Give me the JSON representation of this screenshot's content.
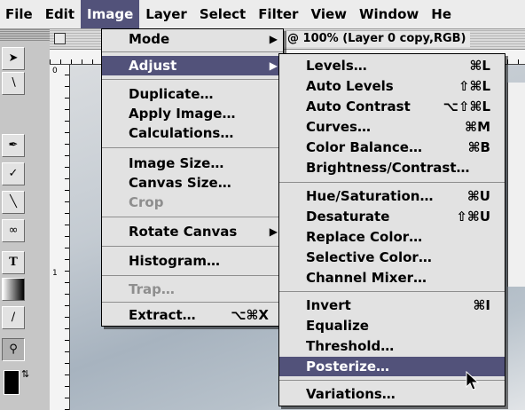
{
  "menubar": [
    "File",
    "Edit",
    "Image",
    "Layer",
    "Select",
    "Filter",
    "View",
    "Window",
    "He"
  ],
  "document": {
    "title": "@ 100% (Layer 0 copy,RGB)",
    "ruler_marks": [
      "0",
      "1"
    ]
  },
  "image_menu": {
    "items": [
      {
        "label": "Mode",
        "submenu": true,
        "shortcut": "",
        "enabled": true
      },
      {
        "label": "Adjust",
        "submenu": true,
        "shortcut": "",
        "enabled": true,
        "highlighted": true
      },
      {
        "label": "Duplicate…",
        "submenu": false,
        "shortcut": "",
        "enabled": true
      },
      {
        "label": "Apply Image…",
        "submenu": false,
        "shortcut": "",
        "enabled": true
      },
      {
        "label": "Calculations…",
        "submenu": false,
        "shortcut": "",
        "enabled": true
      },
      {
        "label": "Image Size…",
        "submenu": false,
        "shortcut": "",
        "enabled": true
      },
      {
        "label": "Canvas Size…",
        "submenu": false,
        "shortcut": "",
        "enabled": true
      },
      {
        "label": "Crop",
        "submenu": false,
        "shortcut": "",
        "enabled": false
      },
      {
        "label": "Rotate Canvas",
        "submenu": true,
        "shortcut": "",
        "enabled": true
      },
      {
        "label": "Histogram…",
        "submenu": false,
        "shortcut": "",
        "enabled": true
      },
      {
        "label": "Trap…",
        "submenu": false,
        "shortcut": "",
        "enabled": false
      },
      {
        "label": "Extract…",
        "submenu": false,
        "shortcut": "⌥⌘X",
        "enabled": true
      }
    ]
  },
  "adjust_menu": {
    "items": [
      {
        "label": "Levels…",
        "shortcut": "⌘L"
      },
      {
        "label": "Auto Levels",
        "shortcut": "⇧⌘L"
      },
      {
        "label": "Auto Contrast",
        "shortcut": "⌥⇧⌘L"
      },
      {
        "label": "Curves…",
        "shortcut": "⌘M"
      },
      {
        "label": "Color Balance…",
        "shortcut": "⌘B"
      },
      {
        "label": "Brightness/Contrast…",
        "shortcut": ""
      },
      {
        "label": "Hue/Saturation…",
        "shortcut": "⌘U"
      },
      {
        "label": "Desaturate",
        "shortcut": "⇧⌘U"
      },
      {
        "label": "Replace Color…",
        "shortcut": ""
      },
      {
        "label": "Selective Color…",
        "shortcut": ""
      },
      {
        "label": "Channel Mixer…",
        "shortcut": ""
      },
      {
        "label": "Invert",
        "shortcut": "⌘I"
      },
      {
        "label": "Equalize",
        "shortcut": ""
      },
      {
        "label": "Threshold…",
        "shortcut": ""
      },
      {
        "label": "Posterize…",
        "shortcut": "",
        "highlighted": true
      },
      {
        "label": "Variations…",
        "shortcut": ""
      }
    ]
  },
  "toolbox": {
    "tools": [
      "move-tool",
      "magic-wand-tool",
      "brush-tool",
      "history-brush-tool",
      "line-tool",
      "lasso-tool",
      "type-tool",
      "gradient-tool",
      "eyedropper-tool",
      "zoom-tool",
      "foreground-color-swatch"
    ]
  },
  "colors": {
    "highlight": "#52527a",
    "menu_bg": "#e2e2e2",
    "disabled_text": "#8e8e8e"
  },
  "cursor": "arrow-cursor"
}
